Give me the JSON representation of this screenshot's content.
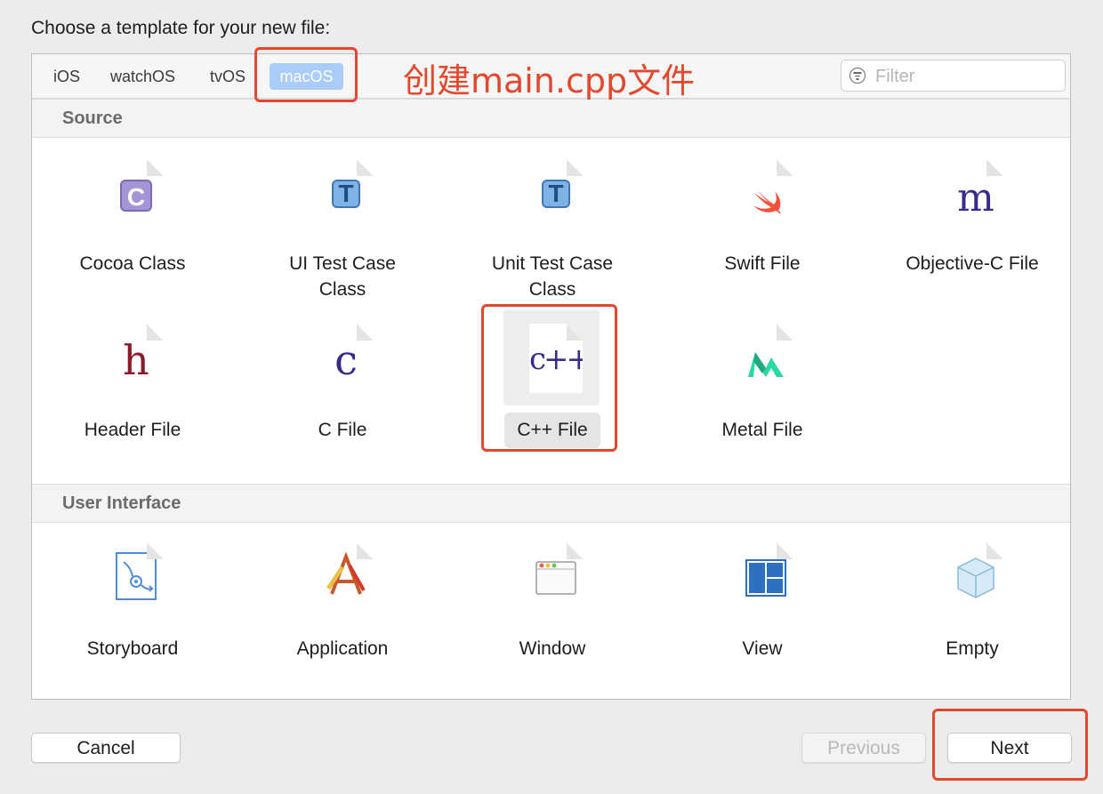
{
  "prompt": "Choose a template for your new file:",
  "tabs": {
    "ios": "iOS",
    "watchos": "watchOS",
    "tvos": "tvOS",
    "macos": "macOS"
  },
  "filter": {
    "placeholder": "Filter",
    "value": ""
  },
  "annotation": "创建main.cpp文件",
  "annotation_color": "#e3472c",
  "sections": {
    "source": "Source",
    "user_interface": "User Interface"
  },
  "source_items": {
    "cocoa_class": "Cocoa Class",
    "ui_test_line1": "UI Test Case",
    "ui_test_line2": "Class",
    "unit_test_line1": "Unit Test Case",
    "unit_test_line2": "Class",
    "swift": "Swift File",
    "objc": "Objective-C File",
    "header": "Header File",
    "c": "C File",
    "cpp": "C++ File",
    "metal": "Metal File"
  },
  "ui_items": {
    "storyboard": "Storyboard",
    "application": "Application",
    "window": "Window",
    "view": "View",
    "empty": "Empty"
  },
  "icon_glyphs": {
    "c": "C",
    "t": "T",
    "m": "m",
    "h": "h",
    "cfile": "c",
    "cpp": "c++"
  },
  "buttons": {
    "cancel": "Cancel",
    "previous": "Previous",
    "next": "Next"
  },
  "selected": "C++ File"
}
